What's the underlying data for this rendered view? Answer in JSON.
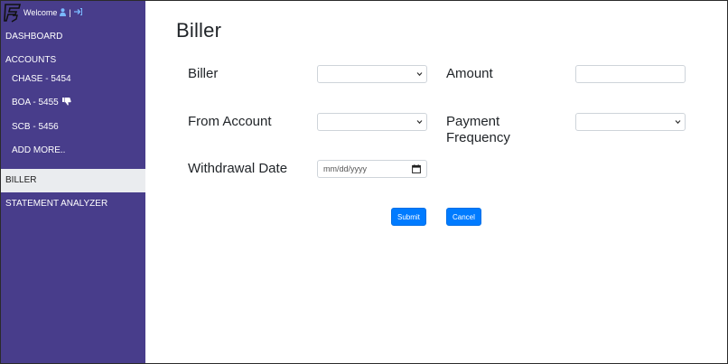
{
  "sidebar": {
    "welcome": "Welcome",
    "separator": "|",
    "user_icon": "user-icon",
    "logout_icon": "sign-out-icon",
    "nav": {
      "dashboard": "DASHBOARD",
      "accounts": "ACCOUNTS",
      "chase": "CHASE - 5454",
      "boa": "BOA - 5455",
      "scb": "SCB - 5456",
      "add_more": "ADD MORE..",
      "biller": "BILLER",
      "statement_analyzer": "STATEMENT ANALYZER"
    },
    "active_item": "BILLER"
  },
  "main": {
    "title": "Biller",
    "form": {
      "biller_label": "Biller",
      "amount_label": "Amount",
      "from_account_label": "From Account",
      "payment_frequency_label_line1": "Payment",
      "payment_frequency_label_line2": "Frequency",
      "withdrawal_date_label": "Withdrawal Date",
      "biller_value": "",
      "amount_value": "",
      "from_account_value": "",
      "payment_frequency_value": "",
      "withdrawal_date_placeholder": "mm/dd/yyyy"
    },
    "buttons": {
      "submit": "Submit",
      "cancel": "Cancel"
    }
  },
  "colors": {
    "sidebar_bg": "#483d8b",
    "active_bg": "#eaecef",
    "primary": "#007bff"
  }
}
